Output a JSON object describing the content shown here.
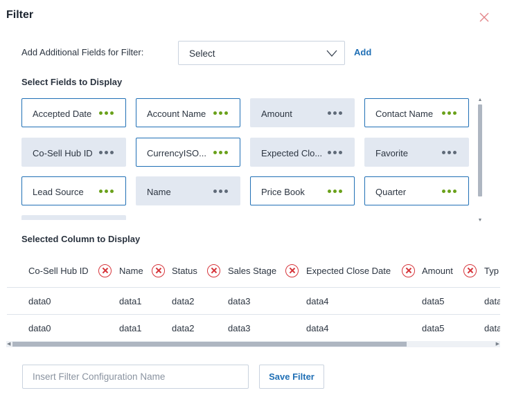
{
  "dialog": {
    "title": "Filter"
  },
  "add_fields": {
    "label": "Add Additional Fields for Filter:",
    "select_value": "Select",
    "add_label": "Add"
  },
  "fields_section": {
    "label": "Select Fields to Display"
  },
  "fields": [
    {
      "label": "Accepted Date",
      "selected": true
    },
    {
      "label": "Account Name",
      "selected": true
    },
    {
      "label": "Amount",
      "selected": false
    },
    {
      "label": "Contact Name",
      "selected": true
    },
    {
      "label": "Co-Sell Hub ID",
      "selected": false
    },
    {
      "label": "CurrencyISO...",
      "selected": true
    },
    {
      "label": "Expected Clo...",
      "selected": false
    },
    {
      "label": "Favorite",
      "selected": false
    },
    {
      "label": "Lead Source",
      "selected": true
    },
    {
      "label": "Name",
      "selected": false
    },
    {
      "label": "Price Book",
      "selected": true
    },
    {
      "label": "Quarter",
      "selected": true
    }
  ],
  "columns_section": {
    "label": "Selected Column to Display"
  },
  "columns": [
    "Co-Sell Hub ID",
    "Name",
    "Status",
    "Sales Stage",
    "Expected Close Date",
    "Amount",
    "Typ"
  ],
  "rows": [
    [
      "data0",
      "data1",
      "data2",
      "data3",
      "data4",
      "data5",
      "data"
    ],
    [
      "data0",
      "data1",
      "data2",
      "data3",
      "data4",
      "data5",
      "data"
    ]
  ],
  "footer": {
    "input_placeholder": "Insert Filter Configuration Name",
    "save_label": "Save Filter"
  },
  "colors": {
    "accent": "#1f6fb5",
    "remove": "#d6343a",
    "selected_dots": "#6aa11b",
    "unselected_chip": "#e2e8f1"
  }
}
